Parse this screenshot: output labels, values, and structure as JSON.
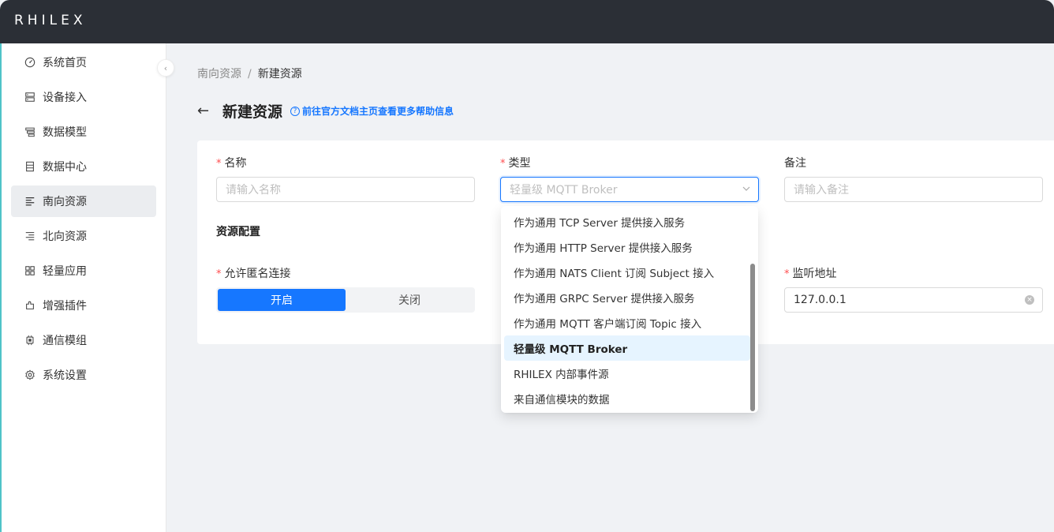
{
  "app": {
    "logo": "RHILEX"
  },
  "sidebar": {
    "items": [
      {
        "label": "系统首页",
        "icon": "dashboard-icon"
      },
      {
        "label": "设备接入",
        "icon": "device-icon"
      },
      {
        "label": "数据模型",
        "icon": "model-icon"
      },
      {
        "label": "数据中心",
        "icon": "database-icon"
      },
      {
        "label": "南向资源",
        "icon": "southbound-icon",
        "active": true
      },
      {
        "label": "北向资源",
        "icon": "northbound-icon"
      },
      {
        "label": "轻量应用",
        "icon": "apps-icon"
      },
      {
        "label": "增强插件",
        "icon": "plugin-icon"
      },
      {
        "label": "通信模组",
        "icon": "chip-icon"
      },
      {
        "label": "系统设置",
        "icon": "settings-icon"
      }
    ]
  },
  "breadcrumb": {
    "parent": "南向资源",
    "separator": "/",
    "current": "新建资源"
  },
  "page": {
    "title": "新建资源",
    "help_link": "前往官方文档主页查看更多帮助信息"
  },
  "form": {
    "name_label": "名称",
    "name_placeholder": "请输入名称",
    "type_label": "类型",
    "type_value": "轻量级 MQTT Broker",
    "remark_label": "备注",
    "remark_placeholder": "请输入备注",
    "section_title": "资源配置",
    "anon_label": "允许匿名连接",
    "anon_on": "开启",
    "anon_off": "关闭",
    "listen_label": "监听地址",
    "listen_value": "127.0.0.1"
  },
  "dropdown": {
    "options": [
      "作为通用 TCP Server 提供接入服务",
      "作为通用 HTTP Server 提供接入服务",
      "作为通用 NATS Client 订阅 Subject 接入",
      "作为通用 GRPC Server 提供接入服务",
      "作为通用 MQTT 客户端订阅 Topic 接入",
      "轻量级 MQTT Broker",
      "RHILEX 内部事件源",
      "来自通信模块的数据"
    ],
    "selected_index": 5
  },
  "colors": {
    "primary": "#1677ff",
    "topbar": "#2b2f36",
    "required": "#ff4d4f"
  }
}
